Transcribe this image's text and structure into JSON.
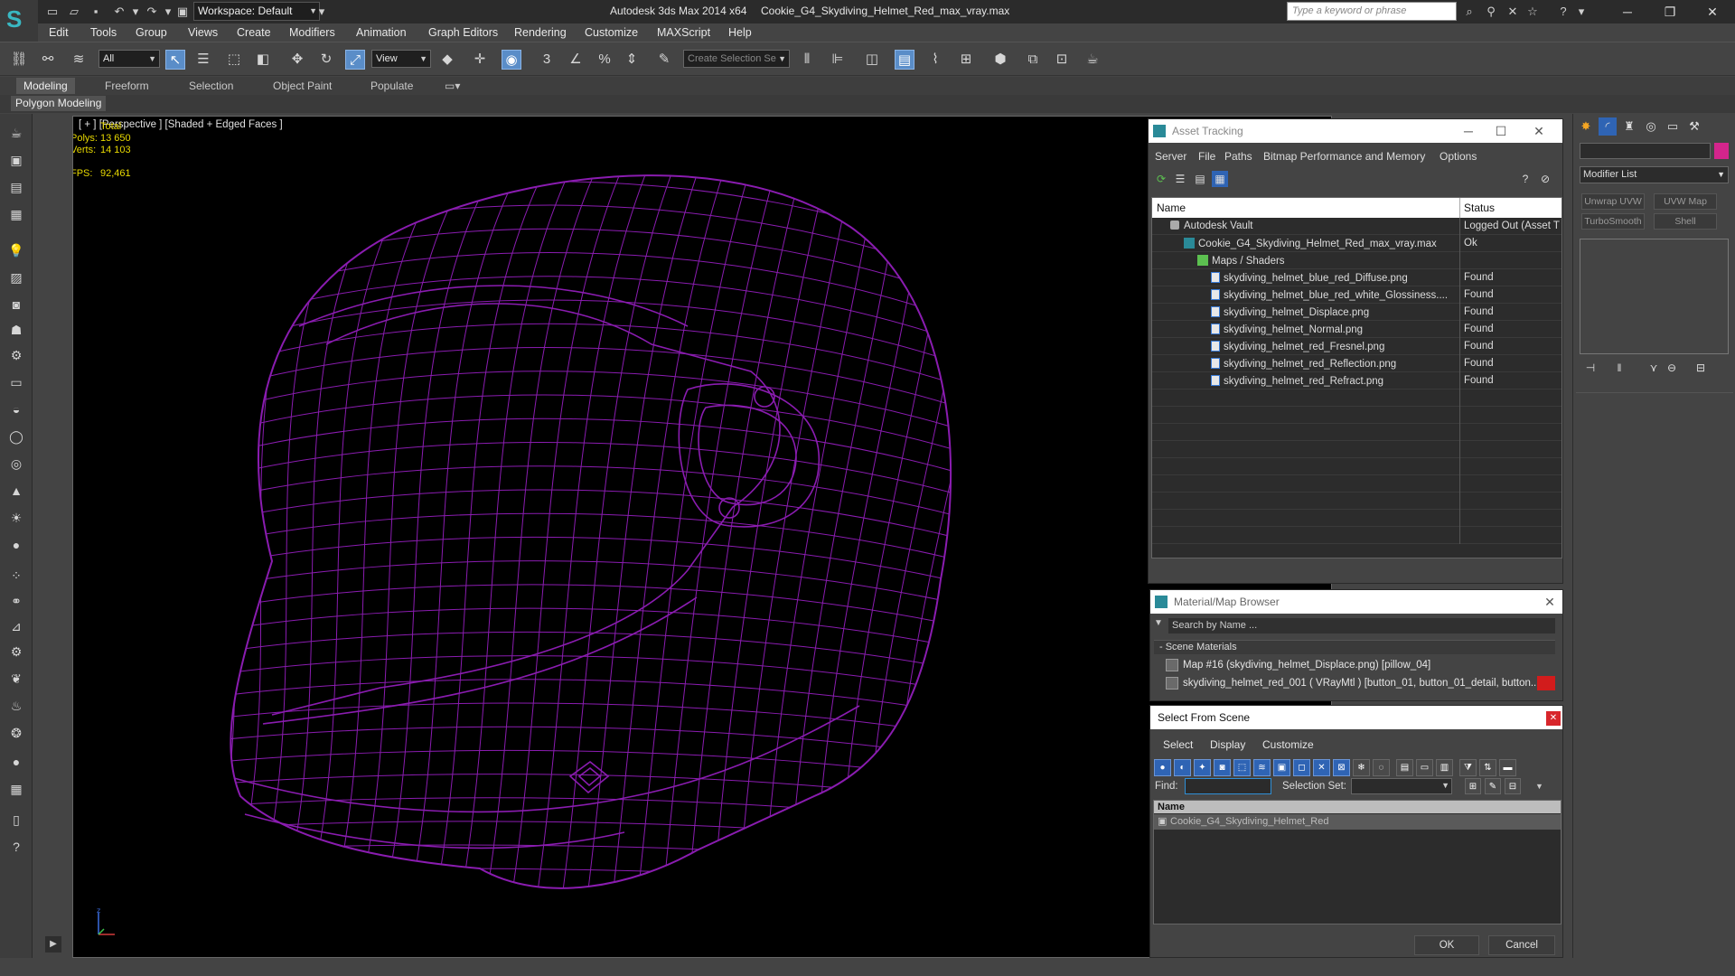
{
  "titlebar": {
    "workspace": "Workspace: Default",
    "app_name": "Autodesk 3ds Max  2014 x64",
    "file_name": "Cookie_G4_Skydiving_Helmet_Red_max_vray.max",
    "search_placeholder": "Type a keyword or phrase"
  },
  "menu": [
    "Edit",
    "Tools",
    "Group",
    "Views",
    "Create",
    "Modifiers",
    "Animation",
    "Graph Editors",
    "Rendering",
    "Customize",
    "MAXScript",
    "Help"
  ],
  "toolbar": {
    "filter_value": "All",
    "refcoord_value": "View",
    "selection_set_placeholder": "Create Selection Se"
  },
  "ribbon": {
    "tabs": [
      "Modeling",
      "Freeform",
      "Selection",
      "Object Paint",
      "Populate"
    ],
    "active_tab": "Modeling",
    "panel_label": "Polygon Modeling"
  },
  "viewport": {
    "label": "[ + ] [Perspective ] [Shaded + Edged Faces ]",
    "stats_header": "Total",
    "polys_label": "Polys:",
    "polys_value": "13 650",
    "verts_label": "Verts:",
    "verts_value": "14 103",
    "fps_label": "FPS:",
    "fps_value": "92,461",
    "wire_color": "#8a1cb0"
  },
  "asset_tracking": {
    "title": "Asset Tracking",
    "menus": [
      "Server",
      "File",
      "Paths",
      "Bitmap Performance and Memory",
      "Options"
    ],
    "columns": [
      "Name",
      "Status"
    ],
    "rows": [
      {
        "name": "Autodesk Vault",
        "status": "Logged Out (Asset T"
      },
      {
        "name": "Cookie_G4_Skydiving_Helmet_Red_max_vray.max",
        "status": "Ok"
      },
      {
        "name": "Maps / Shaders",
        "status": ""
      },
      {
        "name": "skydiving_helmet_blue_red_Diffuse.png",
        "status": "Found"
      },
      {
        "name": "skydiving_helmet_blue_red_white_Glossiness....",
        "status": "Found"
      },
      {
        "name": "skydiving_helmet_Displace.png",
        "status": "Found"
      },
      {
        "name": "skydiving_helmet_Normal.png",
        "status": "Found"
      },
      {
        "name": "skydiving_helmet_red_Fresnel.png",
        "status": "Found"
      },
      {
        "name": "skydiving_helmet_red_Reflection.png",
        "status": "Found"
      },
      {
        "name": "skydiving_helmet_red_Refract.png",
        "status": "Found"
      }
    ]
  },
  "material_browser": {
    "title": "Material/Map Browser",
    "search_placeholder": "Search by Name ...",
    "section": "- Scene Materials",
    "items": [
      "Map #16 (skydiving_helmet_Displace.png) [pillow_04]",
      "skydiving_helmet_red_001  ( VRayMtl ) [button_01, button_01_detail, button..."
    ]
  },
  "select_from_scene": {
    "title": "Select From Scene",
    "menus": [
      "Select",
      "Display",
      "Customize"
    ],
    "find_label": "Find:",
    "selection_set_label": "Selection Set:",
    "column": "Name",
    "row": "Cookie_G4_Skydiving_Helmet_Red",
    "ok": "OK",
    "cancel": "Cancel"
  },
  "command_panel": {
    "modifier_list": "Modifier List",
    "modifiers": [
      "Unwrap UVW",
      "UVW Map",
      "TurboSmooth",
      "Shell"
    ],
    "object_color": "#d4258c"
  }
}
